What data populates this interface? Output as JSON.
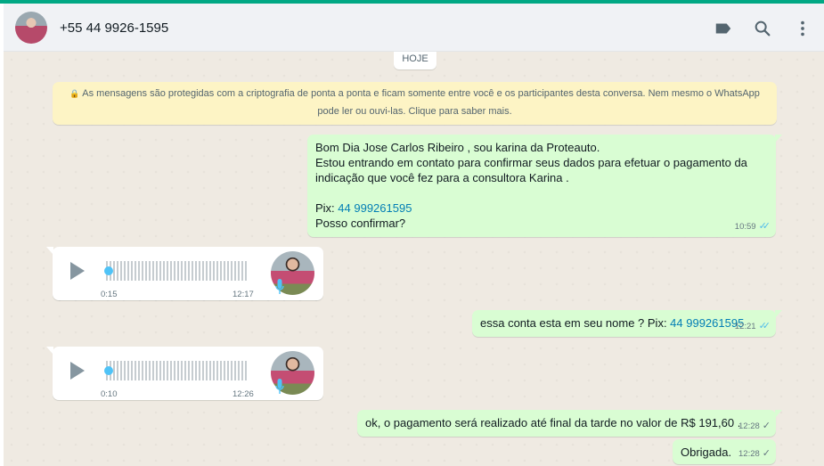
{
  "header": {
    "contact_name": "+55 44 9926-1595",
    "icons": [
      "label-icon",
      "search-icon",
      "menu-icon"
    ]
  },
  "chat": {
    "date_chip": "HOJE",
    "encryption_notice": {
      "line1": "As mensagens são protegidas com a criptografia de ponta a ponta e ficam somente entre você e os participantes desta conversa. Nem mesmo o WhatsApp",
      "line2": "pode ler ou ouvi-las. Clique para saber mais."
    },
    "messages": [
      {
        "direction": "out",
        "line1": "Bom Dia Jose Carlos Ribeiro   , sou karina da Proteauto.",
        "line2": "Estou entrando em contato para confirmar seus dados para efetuar o pagamento da",
        "line3": "indicação que você fez para a consultora Karina .",
        "pix_label": "Pix: ",
        "pix_number": "44 999261595",
        "line5": "Posso confirmar?",
        "time": "10:59",
        "status": "read"
      },
      {
        "direction": "in",
        "type": "voice",
        "duration": "0:15",
        "time": "12:17"
      },
      {
        "direction": "out",
        "text": "essa conta esta em seu nome ? Pix: ",
        "pix_number": "44 999261595",
        "time": "12:21",
        "status": "read"
      },
      {
        "direction": "in",
        "type": "voice",
        "duration": "0:10",
        "time": "12:26"
      },
      {
        "direction": "out",
        "text": "ok, o pagamento será realizado até final da tarde no valor de R$ 191,60 .",
        "time": "12:28",
        "status": "sent"
      },
      {
        "direction": "out",
        "text": "Obrigada.",
        "time": "12:28",
        "status": "sent"
      }
    ]
  },
  "colors": {
    "accent": "#00a884",
    "outgoing_bubble": "#d9fdd3",
    "incoming_bubble": "#ffffff",
    "read_ticks": "#53bdeb",
    "link": "#027eb5"
  }
}
